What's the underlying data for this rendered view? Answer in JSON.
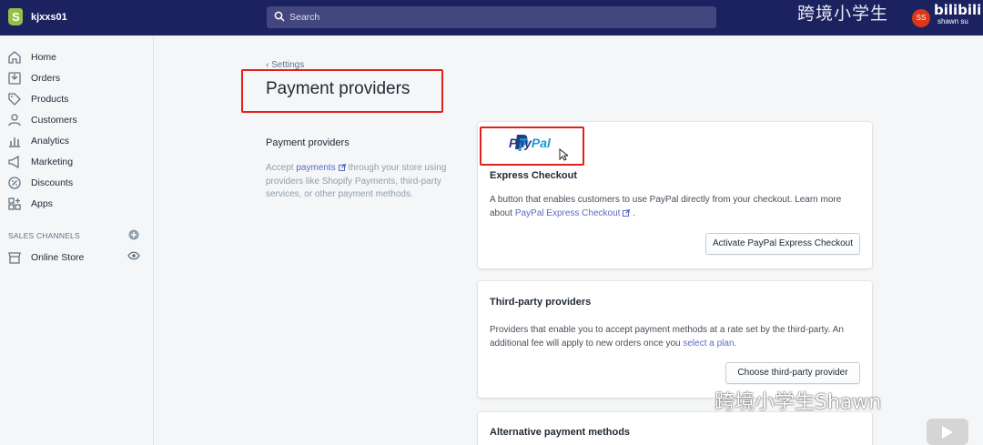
{
  "topbar": {
    "store_name": "kjxxs01",
    "search_placeholder": "Search",
    "watermark": "跨境小学生",
    "bilibili": "bilibili",
    "bilibili_user": "shawn su",
    "avatar_initials": "SS"
  },
  "sidebar": {
    "items": [
      {
        "label": "Home",
        "icon": "home-icon"
      },
      {
        "label": "Orders",
        "icon": "orders-icon"
      },
      {
        "label": "Products",
        "icon": "tag-icon"
      },
      {
        "label": "Customers",
        "icon": "person-icon"
      },
      {
        "label": "Analytics",
        "icon": "bar-chart-icon"
      },
      {
        "label": "Marketing",
        "icon": "megaphone-icon"
      },
      {
        "label": "Discounts",
        "icon": "discount-icon"
      },
      {
        "label": "Apps",
        "icon": "apps-icon"
      }
    ],
    "sales_channels_heading": "SALES CHANNELS",
    "online_store": "Online Store"
  },
  "page": {
    "back_label": "Settings",
    "title": "Payment providers",
    "section_title": "Payment providers",
    "section_desc_pre": "Accept ",
    "section_desc_link": "payments",
    "section_desc_post": " through your store using providers like Shopify Payments, third-party services, or other payment methods."
  },
  "paypal_card": {
    "logo_pay": "Pay",
    "logo_pal": "Pal",
    "title": "Express Checkout",
    "desc": "A button that enables customers to use PayPal directly from your checkout. Learn more about ",
    "desc_link": "PayPal Express Checkout",
    "desc_end": ".",
    "button": "Activate PayPal Express Checkout"
  },
  "third_party_card": {
    "title": "Third-party providers",
    "desc": "Providers that enable you to accept payment methods at a rate set by the third-party. An additional fee will apply to new orders once you ",
    "desc_link": "select a plan",
    "desc_end": ".",
    "button": "Choose third-party provider"
  },
  "alt_card": {
    "title": "Alternative payment methods"
  },
  "watermark_bottom": "跨境小学生Shawn",
  "colors": {
    "topbar": "#1c2260",
    "highlight_border": "#e2211c",
    "link": "#5c6ac4",
    "paypal_dark": "#253b80",
    "paypal_light": "#179bd7"
  }
}
